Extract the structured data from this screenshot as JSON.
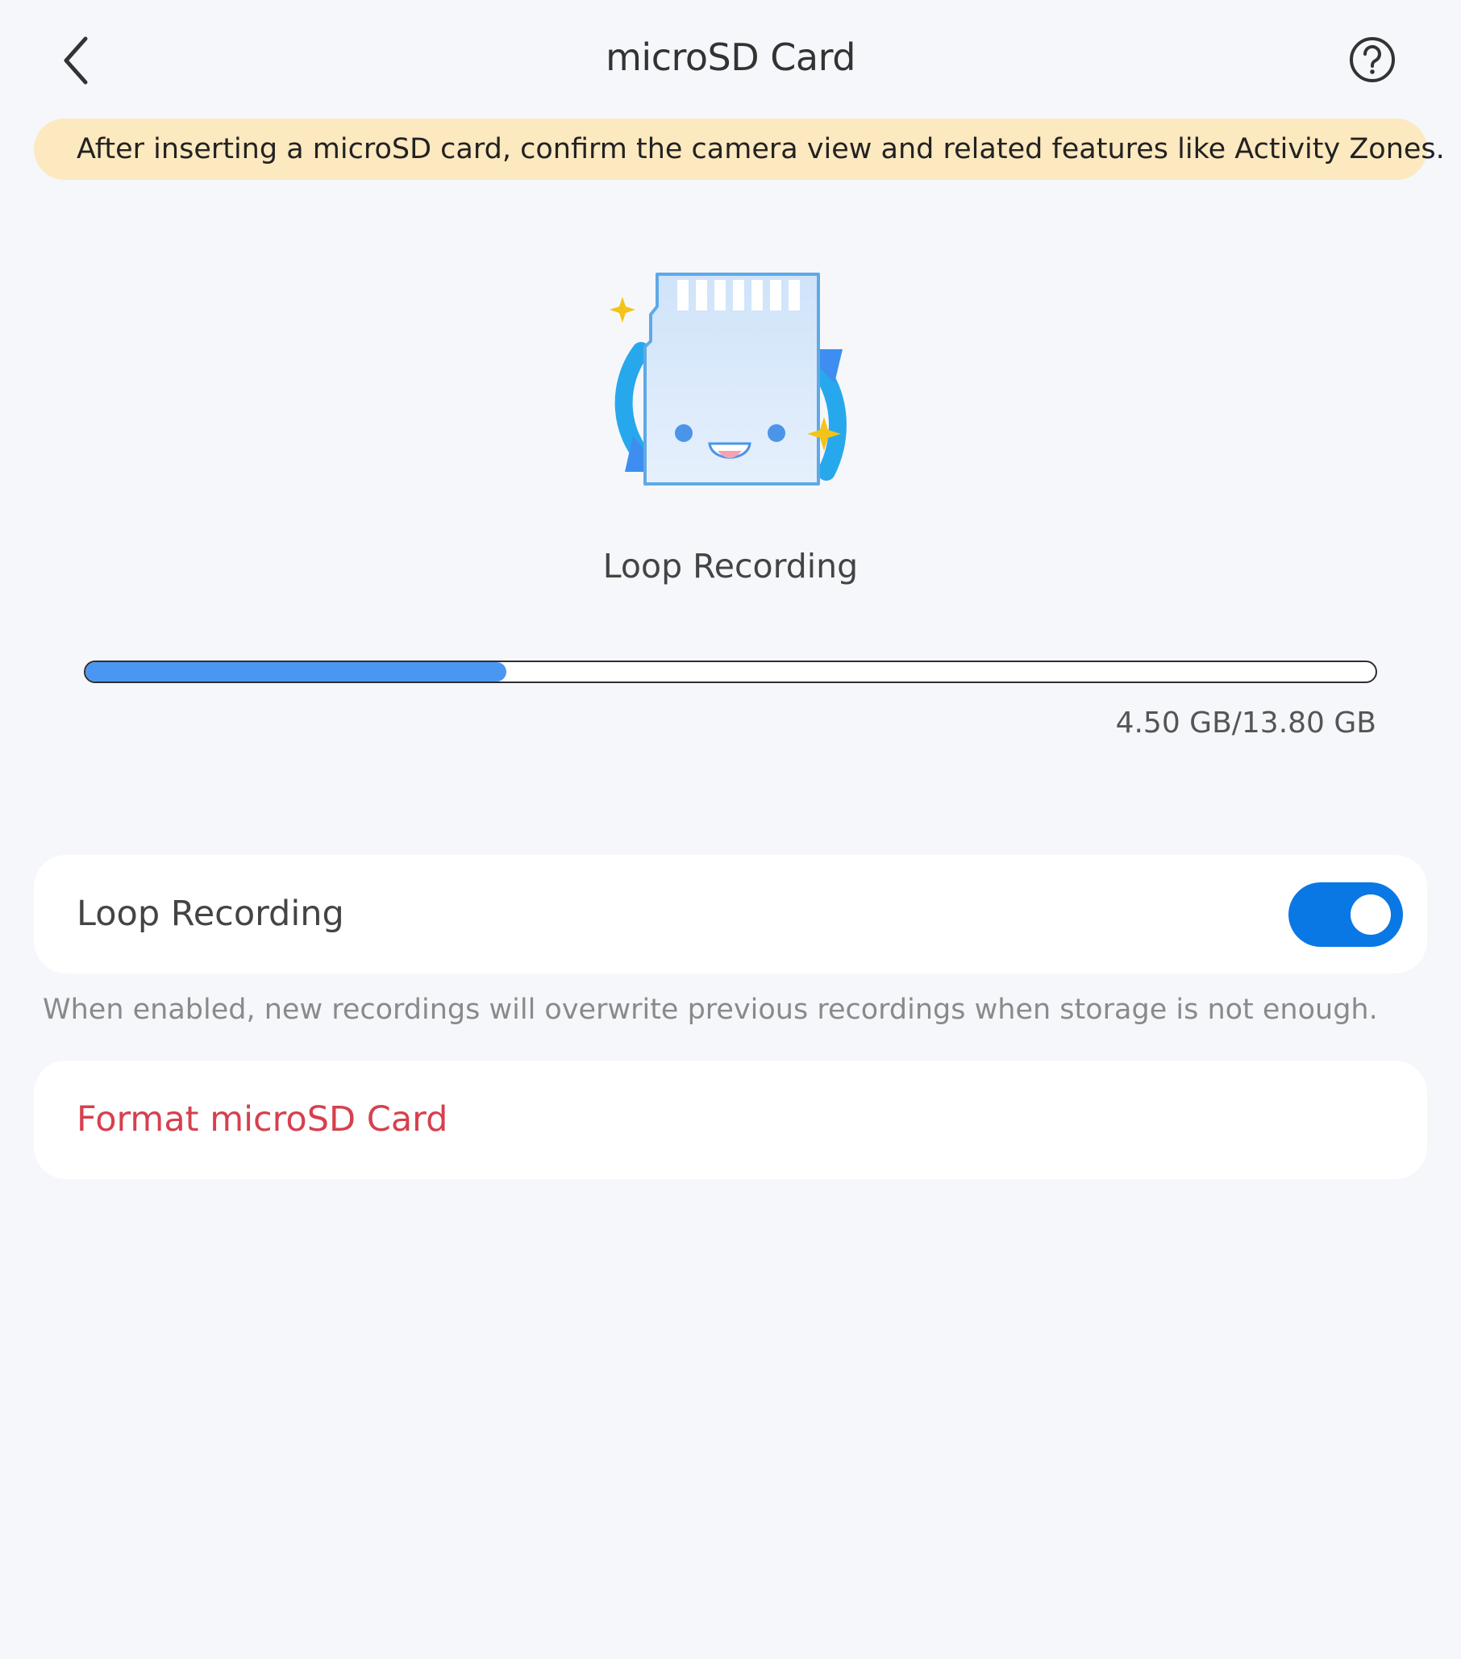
{
  "header": {
    "title": "microSD Card",
    "back_icon": "chevron-left-icon",
    "help_icon": "question-circle-icon"
  },
  "banner": {
    "text": "After inserting a microSD card, confirm the camera view and related features like Activity Zones."
  },
  "storage": {
    "hero_label": "Loop Recording",
    "used_gb": 4.5,
    "total_gb": 13.8,
    "usage_text": "4.50 GB/13.80 GB"
  },
  "loop_recording": {
    "label": "Loop Recording",
    "enabled": true,
    "hint": "When enabled, new recordings will overwrite previous recordings when storage is not enough."
  },
  "format": {
    "label": "Format microSD Card"
  },
  "colors": {
    "background": "#f5f7fb",
    "banner": "#fde9bf",
    "accent": "#0a78e4",
    "progress_fill": "#4a97f2",
    "danger": "#d6404e"
  }
}
